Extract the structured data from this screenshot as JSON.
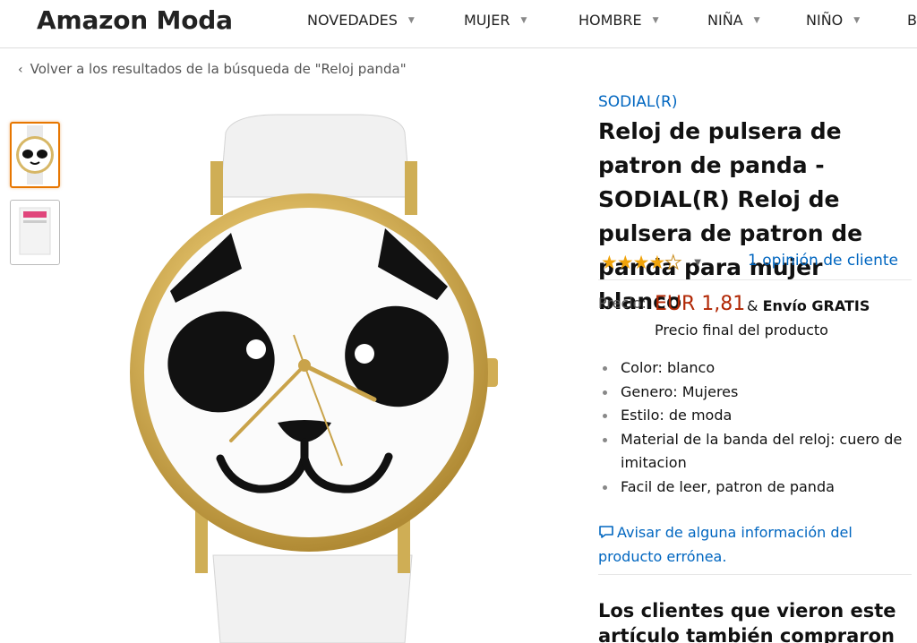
{
  "header": {
    "brand": "Amazon Moda",
    "nav": [
      "NOVEDADES",
      "MUJER",
      "HOMBRE",
      "NIÑA",
      "NIÑO",
      "B"
    ]
  },
  "breadcrumb": {
    "text": "Volver a los resultados de la búsqueda de \"Reloj panda\""
  },
  "product": {
    "store": "SODIAL(R)",
    "title": "Reloj de pulsera de patron de panda - SODIAL(R) Reloj de pulsera de patron de panda para mujer blanco",
    "rating": 4,
    "rating_max": 5,
    "reviews": "1 opinión de cliente",
    "price_label": "Precio:",
    "price": "EUR 1,81",
    "shipping_prefix": "&",
    "shipping": "Envío GRATIS",
    "price_note": "Precio final del producto",
    "features": [
      "Color: blanco",
      "Genero: Mujeres",
      "Estilo: de moda",
      "Material de la banda del reloj: cuero de imitacion",
      "Facil de leer, patron de panda"
    ],
    "report_link": "Avisar de alguna información del producto errónea."
  },
  "also_bought": {
    "title": "Los clientes que vieron este artículo también compraron"
  },
  "colors": {
    "link": "#0066c0",
    "price": "#b12704",
    "star": "#f0a30a",
    "thumb_selected": "#e77600"
  },
  "icons": [
    "chevron-left-icon",
    "chevron-down-icon",
    "message-icon",
    "star-icon"
  ]
}
